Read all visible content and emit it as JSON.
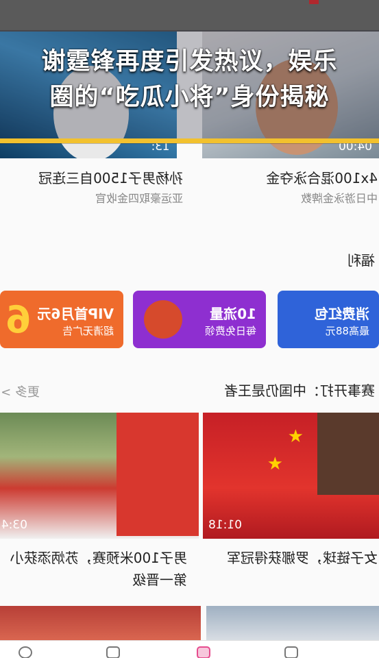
{
  "headline": {
    "line1": "谢霆锋再度引发热议，娱乐",
    "line2": "圈的“吃瓜小将”身份揭秘"
  },
  "video_row_1": [
    {
      "title": "孙杨男子1500自三连冠",
      "subtitle": "亚运豪取四金收官",
      "duration": "13:"
    },
    {
      "title": "4x100混合泳夺金",
      "subtitle": "中日游泳金牌数",
      "duration": "04:00"
    }
  ],
  "welfare_section": {
    "title": "福利"
  },
  "banners": [
    {
      "line1": "消费红包",
      "line2": "最高88元"
    },
    {
      "line1": "10流量",
      "line2": "每日免费领"
    },
    {
      "line1": "VIP首月6元",
      "line2": "超清无广告",
      "badge": "6"
    }
  ],
  "events_section": {
    "title": "赛事开打：中国仍是王者",
    "more_label": "更多 >"
  },
  "video_row_2": [
    {
      "title_line1": "女子链球，罗娜获得冠军",
      "duration": "01:18"
    },
    {
      "title_line1": "男子100米预赛，苏炳添获小",
      "title_line2": "第一晋级",
      "duration": "03:4"
    }
  ],
  "colors": {
    "gold_line": "#f2c12e",
    "banner_blue": "#2f63d9",
    "banner_purple": "#8e2fd0",
    "banner_orange": "#ef6b2c"
  }
}
